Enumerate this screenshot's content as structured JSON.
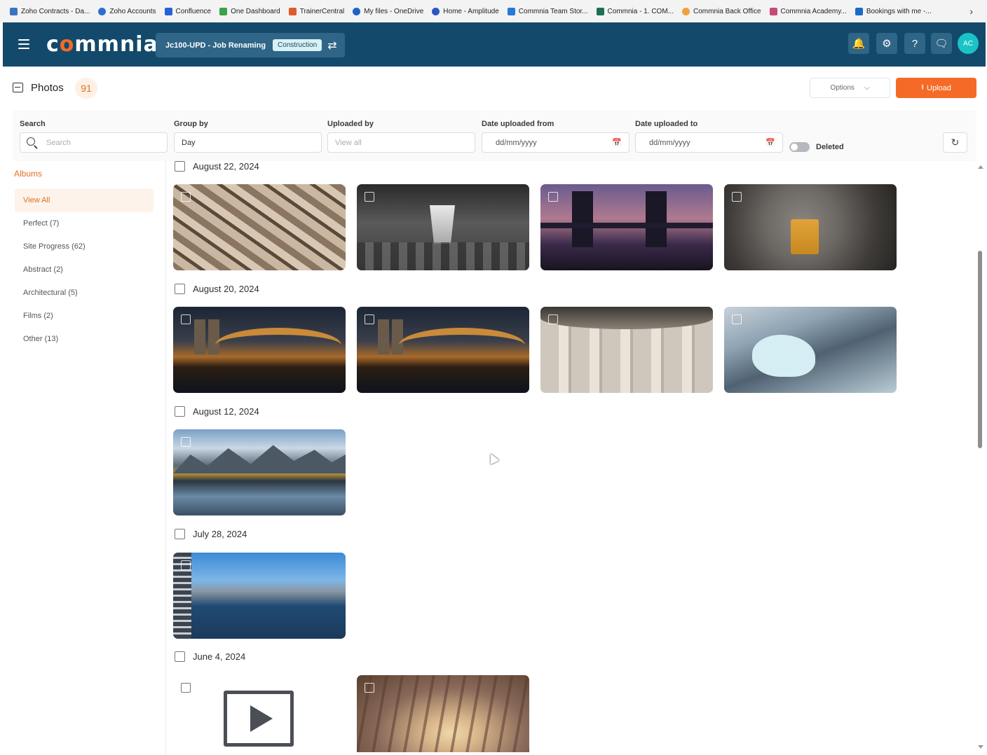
{
  "bookmarks": [
    {
      "label": "Zoho Contracts - Da...",
      "color": "#3b73c4"
    },
    {
      "label": "Zoho Accounts",
      "color": "#2e6fd0"
    },
    {
      "label": "Confluence",
      "color": "#2463d6"
    },
    {
      "label": "One Dashboard",
      "color": "#3aa34a"
    },
    {
      "label": "TrainerCentral",
      "color": "#e05a2b"
    },
    {
      "label": "My files - OneDrive",
      "color": "#1e63c8"
    },
    {
      "label": "Home - Amplitude",
      "color": "#2e55c8"
    },
    {
      "label": "Commnia Team Stor...",
      "color": "#2a78d8"
    },
    {
      "label": "Commnia - 1. COM...",
      "color": "#1f6e58"
    },
    {
      "label": "Commnia Back Office",
      "color": "#f0a03c"
    },
    {
      "label": "Commnia Academy...",
      "color": "#c44a7a"
    },
    {
      "label": "Bookings with me -...",
      "color": "#1a6bc4"
    }
  ],
  "header": {
    "logo": "commnia",
    "job_title": "Jc100-UPD - Job Renaming",
    "job_badge": "Construction",
    "avatar_initials": "AC",
    "colors": {
      "bar": "#134a6b",
      "accent": "#f56a26",
      "avatar": "#19c3c6"
    }
  },
  "title_bar": {
    "title": "Photos",
    "count": "91",
    "options_label": "Options",
    "upload_label": "Upload"
  },
  "filters": {
    "search_label": "Search",
    "search_placeholder": "Search",
    "group_by_label": "Group by",
    "group_by_value": "Day",
    "uploaded_by_label": "Uploaded by",
    "uploaded_by_placeholder": "View all",
    "date_from_label": "Date uploaded from",
    "date_from_placeholder": "dd/mm/yyyy",
    "date_to_label": "Date uploaded to",
    "date_to_placeholder": "dd/mm/yyyy",
    "deleted_label": "Deleted"
  },
  "albums": {
    "heading": "Albums",
    "items": [
      {
        "label": "View All"
      },
      {
        "label": "Perfect (7)"
      },
      {
        "label": "Site Progress (62)"
      },
      {
        "label": "Abstract (2)"
      },
      {
        "label": "Architectural (5)"
      },
      {
        "label": "Films (2)"
      },
      {
        "label": "Other (13)"
      }
    ]
  },
  "gallery": {
    "groups": [
      {
        "date": "August 22, 2024",
        "photos": [
          "timber-beams-photo",
          "concrete-corridor-photo",
          "tower-bridge-photo",
          "tunnel-drill-photo"
        ]
      },
      {
        "date": "August 20, 2024",
        "photos": [
          "cologne-bridge-photo",
          "cologne-bridge-photo",
          "concrete-pillars-photo",
          "skyscraper-photo"
        ]
      },
      {
        "date": "August 12, 2024",
        "photos": [
          "mountain-lake-photo"
        ]
      },
      {
        "date": "July 28, 2024",
        "photos": [
          "harbor-city-photo"
        ]
      },
      {
        "date": "June 4, 2024",
        "photos": [
          "video-placeholder",
          "tree-tunnel-photo"
        ]
      }
    ]
  }
}
